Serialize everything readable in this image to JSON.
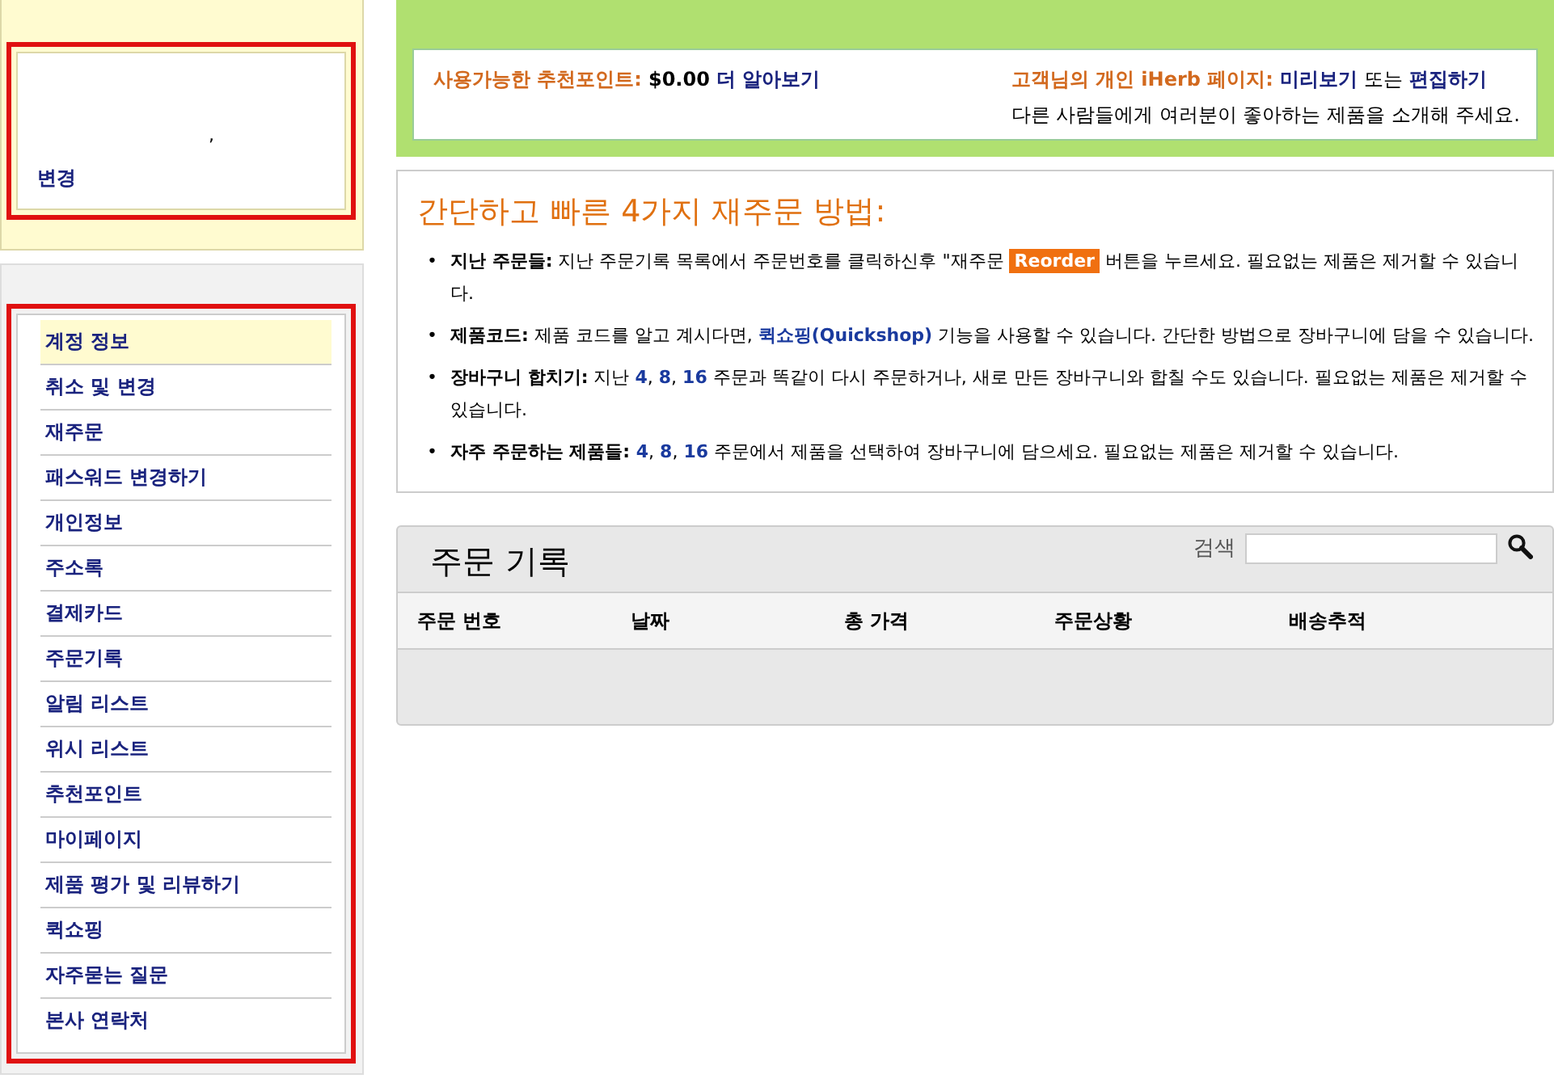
{
  "account": {
    "mark": ",",
    "change_link": "변경"
  },
  "nav": [
    {
      "label": "계정 정보",
      "selected": true
    },
    {
      "label": "취소 및 변경",
      "selected": false
    },
    {
      "label": "재주문",
      "selected": false
    },
    {
      "label": "패스워드 변경하기",
      "selected": false
    },
    {
      "label": "개인정보",
      "selected": false
    },
    {
      "label": "주소록",
      "selected": false
    },
    {
      "label": "결제카드",
      "selected": false
    },
    {
      "label": "주문기록",
      "selected": false
    },
    {
      "label": "알림 리스트",
      "selected": false
    },
    {
      "label": "위시 리스트",
      "selected": false
    },
    {
      "label": "추천포인트",
      "selected": false
    },
    {
      "label": "마이페이지",
      "selected": false
    },
    {
      "label": "제품 평가 및 리뷰하기",
      "selected": false
    },
    {
      "label": "퀵쇼핑",
      "selected": false
    },
    {
      "label": "자주묻는 질문",
      "selected": false
    },
    {
      "label": "본사 연락처",
      "selected": false
    }
  ],
  "rewards": {
    "label": "사용가능한 추천포인트:",
    "amount": "$0.00",
    "link": "더 알아보기"
  },
  "my_page": {
    "label_start": "고객님의 개인",
    "brand": "iHerb",
    "label_end": "페이지:",
    "preview_link": "미리보기",
    "or": "또는",
    "edit_link": "편집하기",
    "description": "다른 사람들에게 여러분이 좋아하는 제품을 소개해 주세요."
  },
  "reorder": {
    "title": "간단하고 빠른 4가지 재주문 방법:",
    "tips": [
      {
        "bullet": "•",
        "parts": [
          {
            "kind": "bold",
            "text": "지난 주문들:"
          },
          {
            "kind": "text",
            "text": " 지난 주문기록 목록에서 주문번호를 클릭하신후 \"재주문 "
          },
          {
            "kind": "badge",
            "text": "Reorder"
          },
          {
            "kind": "text",
            "text": " 버튼을 누르세요. 필요없는 제품은 제거할 수 있습니다."
          }
        ]
      },
      {
        "bullet": "•",
        "parts": [
          {
            "kind": "bold",
            "text": "제품코드:"
          },
          {
            "kind": "text",
            "text": " 제품 코드를 알고 계시다면, "
          },
          {
            "kind": "link",
            "text": "퀵쇼핑(Quickshop)"
          },
          {
            "kind": "text",
            "text": " 기능을 사용할 수 있습니다. 간단한 방법으로 장바구니에 담을 수 있습니다."
          }
        ]
      },
      {
        "bullet": "•",
        "parts": [
          {
            "kind": "bold",
            "text": "장바구니 합치기:"
          },
          {
            "kind": "text",
            "text": " 지난 "
          },
          {
            "kind": "link",
            "text": "4"
          },
          {
            "kind": "text",
            "text": ", "
          },
          {
            "kind": "link",
            "text": "8"
          },
          {
            "kind": "text",
            "text": ", "
          },
          {
            "kind": "link",
            "text": "16"
          },
          {
            "kind": "text",
            "text": " 주문과 똑같이 다시 주문하거나, 새로 만든 장바구니와 합칠 수도 있습니다. 필요없는 제품은 제거할 수 있습니다."
          }
        ]
      },
      {
        "bullet": "•",
        "parts": [
          {
            "kind": "bold",
            "text": "자주 주문하는 제품들: "
          },
          {
            "kind": "link",
            "text": "4"
          },
          {
            "kind": "text",
            "text": ", "
          },
          {
            "kind": "link",
            "text": "8"
          },
          {
            "kind": "text",
            "text": ", "
          },
          {
            "kind": "link",
            "text": "16"
          },
          {
            "kind": "text",
            "text": " 주문에서 제품을 선택하여 장바구니에 담으세요. 필요없는 제품은 제거할 수 있습니다."
          }
        ]
      }
    ]
  },
  "orders": {
    "title": "주문 기록",
    "search_label": "검색",
    "columns": [
      "주문 번호",
      "날짜",
      "총 가격",
      "주문상황",
      "배송추적"
    ]
  }
}
